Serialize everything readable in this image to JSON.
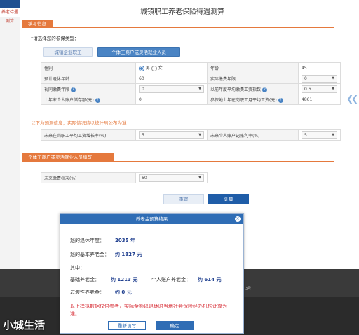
{
  "sidebar": {
    "item": "养老待遇测算"
  },
  "page_title": "城镇职工养老保险待遇测算",
  "section1": {
    "tag": "填写信息"
  },
  "prompt": "*请选择您的参保类型：",
  "type_buttons": [
    "城镇企业职工",
    "个体工商户或灵活就业人员"
  ],
  "form": {
    "gender_label": "性别",
    "gender_male": "男",
    "gender_female": "女",
    "age_label": "年龄",
    "age_value": "45",
    "retire_age_label": "预计退休年龄",
    "retire_age_value": "60",
    "actual_years_label": "实际缴费年限",
    "actual_years_value": "0",
    "deemed_years_label": "视同缴费年限",
    "deemed_years_value": "0",
    "wage_index_label": "以前年度平均缴费工资指数",
    "wage_index_value": "0.6",
    "account_balance_label": "上年末个人账户储存额(元)",
    "account_balance_value": "0",
    "avg_wage_label": "参保地上年在岗职工月平均工资(元)",
    "avg_wage_value": "4861"
  },
  "forecast_note": "以下为预测信息，实际情况请以统计局公布为准",
  "forecast": {
    "growth_label": "未来在岗职工平均工资增长率(%)",
    "growth_value": "5",
    "interest_label": "未来个人账户记账利率(%)",
    "interest_value": "5"
  },
  "section2": {
    "tag": "个体工商户或灵活就业人员填写"
  },
  "grade": {
    "label": "未来缴费档次(%)",
    "value": "60"
  },
  "actions": {
    "reset": "重置",
    "calc": "计算"
  },
  "footer": {
    "fragment": "3号"
  },
  "modal": {
    "title": "养老金预算结果",
    "close": "×",
    "retire_year_label": "您的退休年度：",
    "retire_year_value": "2035 年",
    "basic_pension_label": "您的基本养老金：",
    "basic_pension_value": "约 1827 元",
    "among_label": "其中：",
    "base_label": "基础养老金：",
    "base_value": "约 1213 元",
    "personal_label": "个人账户养老金：",
    "personal_value": "约 614 元",
    "transition_label": "过渡性养老金：",
    "transition_value": "约 0 元",
    "note": "以上模拟数据仅供参考，实际金额以退休时当地社会保险经办机构计算为准。",
    "btn_refill": "重新填写",
    "btn_ok": "确定"
  },
  "watermark": "小城生活"
}
